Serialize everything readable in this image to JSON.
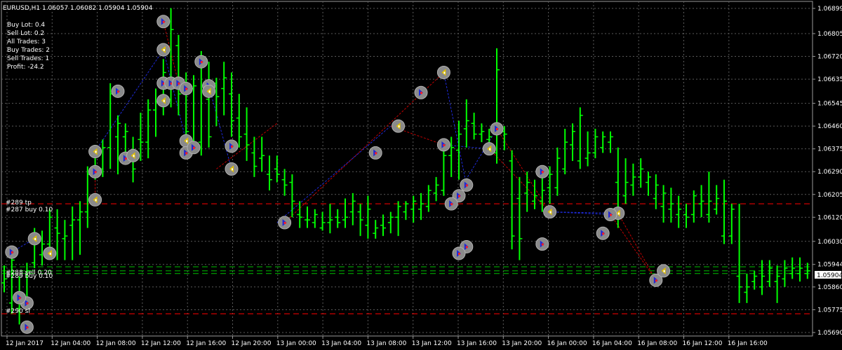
{
  "header": {
    "symbol_line": "EURUSD,H1  1.06057 1.06082 1.05904 1.05904"
  },
  "info_panel": {
    "lines": [
      "Buy Lot: 0.4",
      "Sell Lot: 0.2",
      "All Trades: 3",
      "Buy Trades: 2",
      "Sell Trades: 1",
      "Profit: -24.2"
    ]
  },
  "order_labels": {
    "tp_289": "#289 tp",
    "buy_287": "#287 buy 0.10",
    "sl_288": "#288 sell 0.20",
    "buy_289": "#289 buy 0.10",
    "sl_290": "#290 sl"
  },
  "current_price": "1.05904",
  "colors": {
    "background": "#000000",
    "grid": "#5a5a5a",
    "bull_candle": "#00ff00",
    "axis_text": "#ffffff",
    "order_line_red": "#ff0000",
    "order_line_green": "#00c000",
    "trade_line_blue": "#1e2ad8",
    "trade_line_red": "#c00000",
    "price_box_bg": "#ffffff",
    "marker_fill": "#8a8a8a"
  },
  "chart_data": {
    "type": "candlestick",
    "y_ticks": [
      "1.06899",
      "1.06805",
      "1.06720",
      "1.06635",
      "1.06545",
      "1.06460",
      "1.06375",
      "1.06290",
      "1.06205",
      "1.06120",
      "1.06030",
      "1.05944",
      "1.05860",
      "1.05775",
      "1.05690"
    ],
    "x_ticks": [
      "12 Jan 2017",
      "12 Jan 04:00",
      "12 Jan 08:00",
      "12 Jan 12:00",
      "12 Jan 16:00",
      "12 Jan 20:00",
      "13 Jan 00:00",
      "13 Jan 04:00",
      "13 Jan 08:00",
      "13 Jan 12:00",
      "13 Jan 16:00",
      "13 Jan 20:00",
      "16 Jan 00:00",
      "16 Jan 04:00",
      "16 Jan 08:00",
      "16 Jan 12:00",
      "16 Jan 16:00"
    ],
    "ylim": [
      1.0566,
      1.0693
    ],
    "order_levels": [
      {
        "price": 1.0617,
        "color": "red"
      },
      {
        "price": 1.05935,
        "color": "green"
      },
      {
        "price": 1.0592,
        "color": "green"
      },
      {
        "price": 1.0591,
        "color": "green"
      },
      {
        "price": 1.0576,
        "color": "red"
      }
    ],
    "candles": [
      [
        1.05875,
        1.0594,
        1.0584,
        1.0589
      ],
      [
        1.058,
        1.0599,
        1.0576,
        1.0596
      ],
      [
        1.0578,
        1.059,
        1.0572,
        1.0584
      ],
      [
        1.0582,
        1.0595,
        1.0579,
        1.0592
      ],
      [
        1.0595,
        1.0608,
        1.0593,
        1.0605
      ],
      [
        1.0598,
        1.0607,
        1.0594,
        1.0602
      ],
      [
        1.0602,
        1.0615,
        1.0598,
        1.0612
      ],
      [
        1.0608,
        1.0615,
        1.0596,
        1.0606
      ],
      [
        1.0604,
        1.0611,
        1.0596,
        1.0605
      ],
      [
        1.0609,
        1.0616,
        1.0596,
        1.0611
      ],
      [
        1.0611,
        1.0618,
        1.0598,
        1.0614
      ],
      [
        1.0614,
        1.0631,
        1.0608,
        1.0628
      ],
      [
        1.0629,
        1.0639,
        1.0626,
        1.0635
      ],
      [
        1.063,
        1.0641,
        1.0627,
        1.0638
      ],
      [
        1.0638,
        1.0662,
        1.063,
        1.0658
      ],
      [
        1.0642,
        1.065,
        1.0628,
        1.0647
      ],
      [
        1.0642,
        1.0647,
        1.0635,
        1.0644
      ],
      [
        1.0636,
        1.0642,
        1.0625,
        1.063
      ],
      [
        1.0641,
        1.0651,
        1.0633,
        1.064
      ],
      [
        1.064,
        1.0656,
        1.0634,
        1.0652
      ],
      [
        1.0652,
        1.066,
        1.0642,
        1.0655
      ],
      [
        1.0656,
        1.0671,
        1.065,
        1.0666
      ],
      [
        1.0656,
        1.069,
        1.0653,
        1.0682
      ],
      [
        1.0676,
        1.068,
        1.065,
        1.0658
      ],
      [
        1.0658,
        1.0666,
        1.0638,
        1.0644
      ],
      [
        1.066,
        1.0665,
        1.064,
        1.0661
      ],
      [
        1.064,
        1.0674,
        1.0635,
        1.067
      ],
      [
        1.0656,
        1.067,
        1.0638,
        1.0642
      ],
      [
        1.0662,
        1.0664,
        1.0646,
        1.0657
      ],
      [
        1.066,
        1.067,
        1.065,
        1.0664
      ],
      [
        1.0658,
        1.0666,
        1.0642,
        1.0648
      ],
      [
        1.0649,
        1.0658,
        1.0638,
        1.0642
      ],
      [
        1.0643,
        1.0653,
        1.0633,
        1.0639
      ],
      [
        1.0636,
        1.0642,
        1.0627,
        1.0631
      ],
      [
        1.0634,
        1.0642,
        1.0629,
        1.0635
      ],
      [
        1.0628,
        1.0635,
        1.0622,
        1.0626
      ],
      [
        1.063,
        1.0635,
        1.0625,
        1.0628
      ],
      [
        1.0626,
        1.063,
        1.062,
        1.0624
      ],
      [
        1.0625,
        1.0628,
        1.0612,
        1.0618
      ],
      [
        1.0613,
        1.0618,
        1.0608,
        1.0612
      ],
      [
        1.0611,
        1.0616,
        1.0608,
        1.0611
      ],
      [
        1.061,
        1.0615,
        1.0608,
        1.0613
      ],
      [
        1.0608,
        1.0614,
        1.0607,
        1.061
      ],
      [
        1.061,
        1.0617,
        1.0606,
        1.0611
      ],
      [
        1.0612,
        1.0615,
        1.0608,
        1.061
      ],
      [
        1.0611,
        1.0619,
        1.0608,
        1.0612
      ],
      [
        1.0614,
        1.0621,
        1.0609,
        1.0618
      ],
      [
        1.0614,
        1.0617,
        1.0605,
        1.0611
      ],
      [
        1.0609,
        1.062,
        1.0604,
        1.0615
      ],
      [
        1.0606,
        1.0611,
        1.0604,
        1.0608
      ],
      [
        1.0609,
        1.0613,
        1.0605,
        1.0608
      ],
      [
        1.061,
        1.0614,
        1.0606,
        1.0612
      ],
      [
        1.0612,
        1.0618,
        1.0605,
        1.0616
      ],
      [
        1.0614,
        1.0618,
        1.0611,
        1.0617
      ],
      [
        1.0615,
        1.062,
        1.061,
        1.0618
      ],
      [
        1.0615,
        1.0621,
        1.0611,
        1.0617
      ],
      [
        1.0616,
        1.0624,
        1.0614,
        1.0622
      ],
      [
        1.0621,
        1.0627,
        1.0618,
        1.0624
      ],
      [
        1.0622,
        1.0639,
        1.062,
        1.0635
      ],
      [
        1.0635,
        1.0642,
        1.0627,
        1.0638
      ],
      [
        1.0637,
        1.0648,
        1.0626,
        1.0643
      ],
      [
        1.0645,
        1.0656,
        1.0638,
        1.0648
      ],
      [
        1.0647,
        1.0651,
        1.0641,
        1.0643
      ],
      [
        1.0643,
        1.0647,
        1.064,
        1.0644
      ],
      [
        1.0641,
        1.0645,
        1.0639,
        1.0642
      ],
      [
        1.0636,
        1.0675,
        1.0632,
        1.0667
      ],
      [
        1.0644,
        1.0646,
        1.0637,
        1.0643
      ],
      [
        1.0633,
        1.0637,
        1.06,
        1.0605
      ],
      [
        1.0619,
        1.0627,
        1.0596,
        1.0604
      ],
      [
        1.0621,
        1.0629,
        1.0614,
        1.0625
      ],
      [
        1.0618,
        1.0626,
        1.0615,
        1.062
      ],
      [
        1.0618,
        1.0629,
        1.0614,
        1.0622
      ],
      [
        1.0623,
        1.0631,
        1.0617,
        1.0628
      ],
      [
        1.0623,
        1.0638,
        1.062,
        1.0634
      ],
      [
        1.063,
        1.0645,
        1.0628,
        1.064
      ],
      [
        1.0639,
        1.0647,
        1.0633,
        1.0644
      ],
      [
        1.0633,
        1.0653,
        1.063,
        1.065
      ],
      [
        1.0634,
        1.0644,
        1.0631,
        1.0636
      ],
      [
        1.0636,
        1.0645,
        1.0634,
        1.0642
      ],
      [
        1.0638,
        1.0644,
        1.0636,
        1.0642
      ],
      [
        1.064,
        1.0644,
        1.0636,
        1.0642
      ],
      [
        1.0625,
        1.0638,
        1.0608,
        1.0614
      ],
      [
        1.062,
        1.0634,
        1.0617,
        1.0625
      ],
      [
        1.0624,
        1.0632,
        1.062,
        1.0627
      ],
      [
        1.0627,
        1.0634,
        1.0623,
        1.063
      ],
      [
        1.0625,
        1.0629,
        1.062,
        1.0627
      ],
      [
        1.0619,
        1.0628,
        1.0615,
        1.0624
      ],
      [
        1.0616,
        1.0624,
        1.061,
        1.0621
      ],
      [
        1.0615,
        1.0623,
        1.061,
        1.0617
      ],
      [
        1.0613,
        1.062,
        1.0608,
        1.0615
      ],
      [
        1.0613,
        1.0617,
        1.0608,
        1.0612
      ],
      [
        1.0613,
        1.0622,
        1.061,
        1.062
      ],
      [
        1.0617,
        1.0624,
        1.0612,
        1.0618
      ],
      [
        1.0613,
        1.0629,
        1.061,
        1.0618
      ],
      [
        1.0615,
        1.0624,
        1.0613,
        1.0619
      ],
      [
        1.0605,
        1.0626,
        1.0602,
        1.0618
      ],
      [
        1.0605,
        1.0617,
        1.0602,
        1.0615
      ],
      [
        1.059,
        1.0617,
        1.058,
        1.0586
      ],
      [
        1.0584,
        1.0591,
        1.058,
        1.0586
      ],
      [
        1.0588,
        1.0592,
        1.0585,
        1.059
      ],
      [
        1.0586,
        1.0596,
        1.0583,
        1.059
      ],
      [
        1.0588,
        1.0596,
        1.0586,
        1.0593
      ],
      [
        1.0588,
        1.0594,
        1.058,
        1.059
      ],
      [
        1.0589,
        1.0596,
        1.0586,
        1.0593
      ],
      [
        1.0591,
        1.0597,
        1.0589,
        1.0593
      ],
      [
        1.0591,
        1.0597,
        1.0588,
        1.0593
      ],
      [
        1.0591,
        1.0595,
        1.0589,
        1.0592
      ],
      [
        1.0591,
        1.0606,
        1.0589,
        1.0605
      ],
      [
        1.0596,
        1.0608,
        1.0594,
        1.0605
      ],
      [
        1.0602,
        1.0608,
        1.059,
        1.05904
      ]
    ]
  }
}
